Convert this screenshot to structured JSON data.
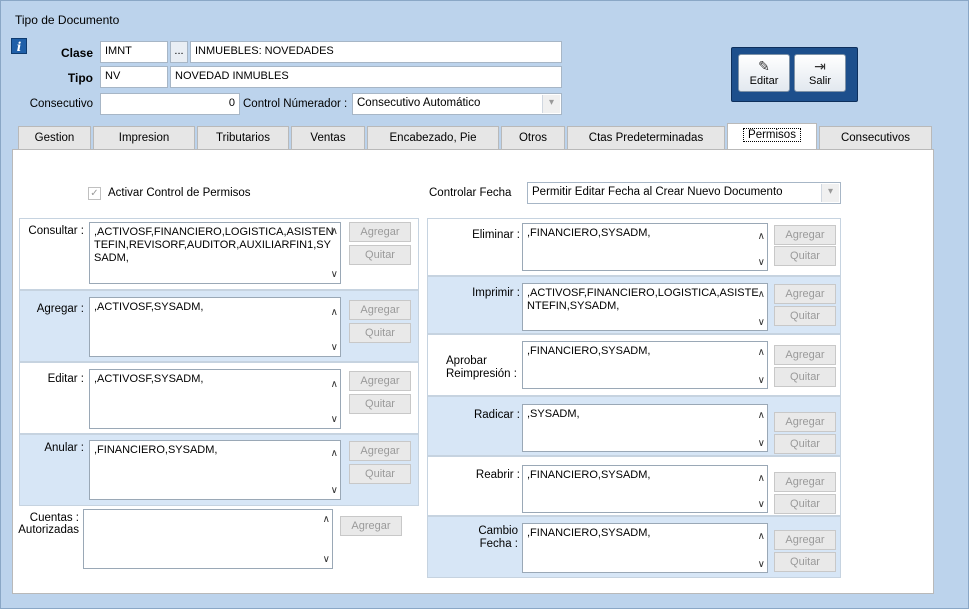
{
  "window": {
    "title": "Tipo de Documento"
  },
  "header": {
    "clase_label": "Clase",
    "clase_code": "IMNT",
    "browse_label": "...",
    "clase_desc": "INMUEBLES: NOVEDADES",
    "tipo_label": "Tipo",
    "tipo_code": "NV",
    "tipo_desc": "NOVEDAD INMUBLES",
    "consecutivo_label": "Consecutivo",
    "consecutivo_value": "0",
    "control_label": "Control Númerador :",
    "control_value": "Consecutivo Automático"
  },
  "toolbar": {
    "edit_label": "Editar",
    "exit_label": "Salir"
  },
  "tabs": [
    {
      "label": "Gestion"
    },
    {
      "label": "Impresion"
    },
    {
      "label": "Tributarios"
    },
    {
      "label": "Ventas"
    },
    {
      "label": "Encabezado, Pie"
    },
    {
      "label": "Otros"
    },
    {
      "label": "Ctas Predeterminadas"
    },
    {
      "label": "Permisos"
    },
    {
      "label": "Consecutivos"
    }
  ],
  "permisos": {
    "activar_label": "Activar Control de Permisos",
    "activar_checked": true,
    "controlar_fecha_label": "Controlar Fecha",
    "controlar_fecha_value": "Permitir Editar Fecha al Crear Nuevo Documento",
    "agregar_btn": "Agregar",
    "quitar_btn": "Quitar",
    "consultar": {
      "label": "Consultar :",
      "value": ",ACTIVOSF,FINANCIERO,LOGISTICA,ASISTENTEFIN,REVISORF,AUDITOR,AUXILIARFIN1,SYSADM,"
    },
    "agregar": {
      "label": "Agregar :",
      "value": ",ACTIVOSF,SYSADM,"
    },
    "editar": {
      "label": "Editar :",
      "value": ",ACTIVOSF,SYSADM,"
    },
    "anular": {
      "label": "Anular :",
      "value": ",FINANCIERO,SYSADM,"
    },
    "cuentas": {
      "label1": "Cuentas :",
      "label2": "Autorizadas",
      "value": ""
    },
    "eliminar": {
      "label": "Eliminar :",
      "value": ",FINANCIERO,SYSADM,"
    },
    "imprimir": {
      "label": "Imprimir :",
      "value": ",ACTIVOSF,FINANCIERO,LOGISTICA,ASISTENTEFIN,SYSADM,"
    },
    "aprobar": {
      "label1": "Aprobar",
      "label2": "Reimpresión :",
      "value": ",FINANCIERO,SYSADM,"
    },
    "radicar": {
      "label": "Radicar :",
      "value": ",SYSADM,"
    },
    "reabrir": {
      "label": "Reabrir :",
      "value": ",FINANCIERO,SYSADM,"
    },
    "cambio": {
      "label1": "Cambio",
      "label2": "Fecha :",
      "value": ",FINANCIERO,SYSADM,"
    }
  }
}
